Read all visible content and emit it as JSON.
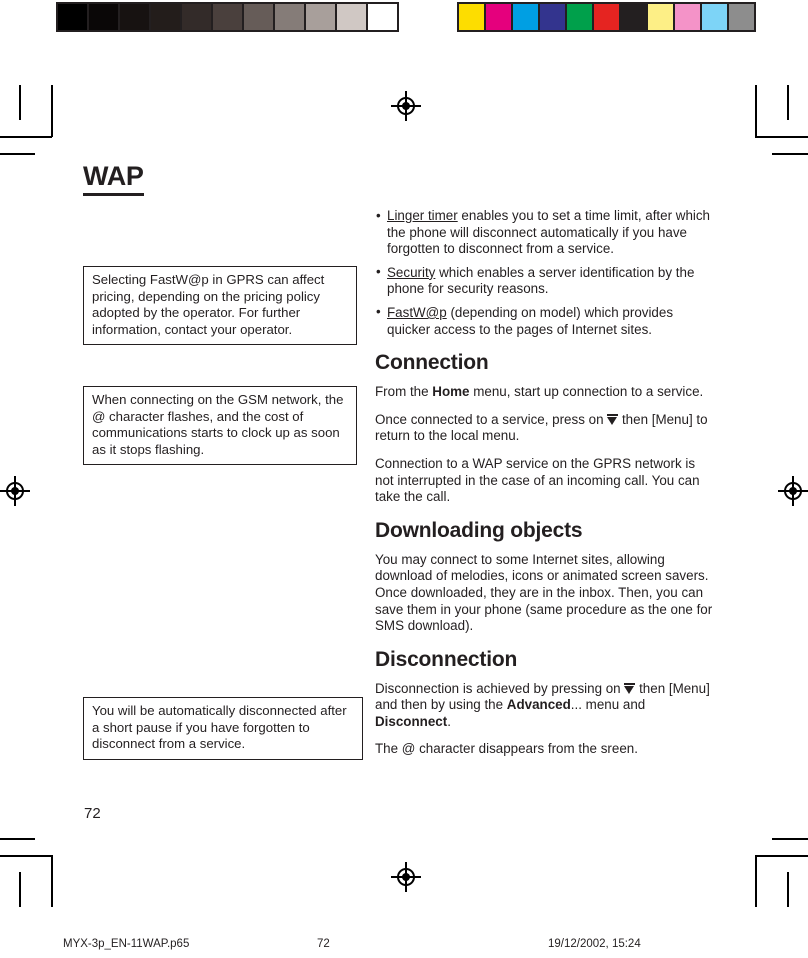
{
  "calibration": {
    "gray_bar": {
      "name": "grayscale-calibration-bar",
      "swatches": [
        "#000000",
        "#0a0707",
        "#171211",
        "#231d1b",
        "#332b29",
        "#4a403d",
        "#665c58",
        "#857c78",
        "#a89f9b",
        "#d0c8c4",
        "#ffffff"
      ]
    },
    "color_bar": {
      "name": "color-calibration-bar",
      "swatches": [
        "#fddd00",
        "#e5007d",
        "#009fe3",
        "#33348e",
        "#00a04b",
        "#e52421",
        "#231f20",
        "#fdef86",
        "#f493c8",
        "#7dd4f7",
        "#8d8d8d"
      ]
    }
  },
  "page": {
    "title": "WAP",
    "number": "72"
  },
  "notes": [
    {
      "id": "note-pricing",
      "text": "Selecting FastW@p in GPRS can affect pricing, depending on the pricing policy adopted by the operator. For further information, contact your operator."
    },
    {
      "id": "note-gsm",
      "text": "When connecting on the GSM network, the @ character flashes, and the cost of communications starts to clock up as soon as it stops flashing."
    },
    {
      "id": "note-autodisc",
      "text": "You will be automatically disconnected after a short pause if you have forgotten to disconnect from a service."
    }
  ],
  "content": {
    "bullets": [
      {
        "term": "Linger timer",
        "rest": " enables you to set a time limit, after which the phone will disconnect automatically if you have forgotten to disconnect from a service."
      },
      {
        "term": "Security",
        "rest": " which enables a server identification by the phone for security reasons."
      },
      {
        "term": "FastW@p",
        "rest": " (depending on model) which provides quicker access to the pages of Internet sites."
      }
    ],
    "sections": [
      {
        "heading": "Connection",
        "paragraphs": [
          {
            "pre": "From the ",
            "bold": "Home",
            "post": " menu, start up connection to a service.",
            "key": false
          },
          {
            "pre": "Once connected to a service, press on ",
            "post": " then [Menu] to return to the local menu.",
            "key": true
          },
          {
            "pre": "Connection to a WAP service on the GPRS network is not interrupted in the case of an incoming call. You can take the call.",
            "key": false
          }
        ]
      },
      {
        "heading": "Downloading objects",
        "paragraphs": [
          {
            "pre": "You may connect to some Internet sites, allowing download of melodies, icons or animated screen savers. Once downloaded, they are in the inbox. Then, you can save them in your phone (same procedure as the one for SMS download).",
            "key": false
          }
        ]
      },
      {
        "heading": "Disconnection",
        "paragraphs": [
          {
            "pre": "Disconnection is achieved by pressing on ",
            "mid": " then [Menu] and then by using the ",
            "bold": "Advanced",
            "post2": "... menu and ",
            "bold2": "Disconnect",
            "post3": ".",
            "key": true
          },
          {
            "pre": "The @ character disappears from the sreen.",
            "key": false
          }
        ]
      }
    ]
  },
  "footer": {
    "filename": "MYX-3p_EN-11WAP.p65",
    "page": "72",
    "timestamp": "19/12/2002, 15:24"
  }
}
